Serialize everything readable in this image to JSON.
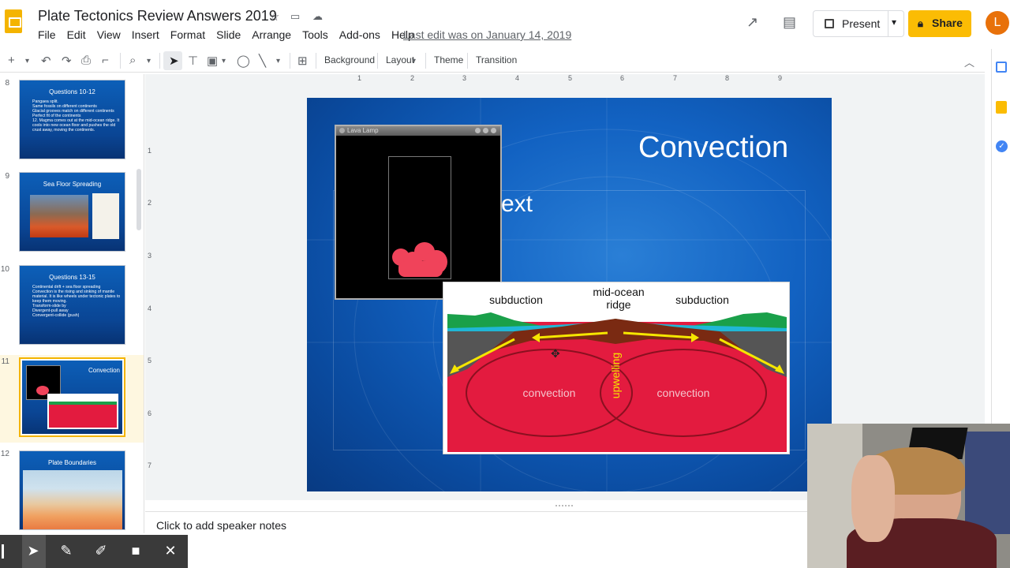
{
  "document": {
    "title": "Plate Tectonics Review Answers 2019",
    "last_edit": "Last edit was on January 14, 2019"
  },
  "menu": [
    "File",
    "Edit",
    "View",
    "Insert",
    "Format",
    "Slide",
    "Arrange",
    "Tools",
    "Add-ons",
    "Help"
  ],
  "header_actions": {
    "present_label": "Present",
    "share_label": "Share",
    "avatar_initial": "L"
  },
  "toolbar": {
    "background_label": "Background",
    "layout_label": "Layout",
    "theme_label": "Theme",
    "transition_label": "Transition"
  },
  "ruler": {
    "horizontal": [
      "1",
      "2",
      "3",
      "4",
      "5",
      "6",
      "7",
      "8",
      "9"
    ],
    "vertical": [
      "1",
      "2",
      "3",
      "4",
      "5",
      "6",
      "7"
    ]
  },
  "slides": [
    {
      "number": "8",
      "title": "Questions 10-12",
      "body": "Pangaea split.\nSame fossils on different continents\nGlacial grooves match on different continents\nPerfect fit of the continents\n12. Magma comes out at the mid-ocean ridge. It cools into new ocean floor and pushes the old crust away, moving the continents."
    },
    {
      "number": "9",
      "title": "Sea Floor Spreading",
      "body": ""
    },
    {
      "number": "10",
      "title": "Questions 13-15",
      "body": "Continental drift + sea floor spreading\nConvection is the rising and sinking of mantle material. It is like wheels under tectonic plates to keep them moving.\nTransform-slide by\nDivergent-pull away\nConvergent-collide (push)"
    },
    {
      "number": "11",
      "title": "Convection",
      "body": ""
    },
    {
      "number": "12",
      "title": "Plate Boundaries",
      "body": ""
    }
  ],
  "selected_slide": "11",
  "slide": {
    "title": "Convection",
    "placeholder_fragment": "ext",
    "lava_window_title": "Lava Lamp",
    "diagram": {
      "label_left": "subduction",
      "label_center": "mid-ocean\nridge",
      "label_right": "subduction",
      "convection_left": "convection",
      "convection_right": "convection",
      "upwelling": "upwelling"
    }
  },
  "speaker_notes_placeholder": "Click to add speaker notes",
  "colors": {
    "slide_blue": "#1262c2",
    "share_yellow": "#fbbc04",
    "selection_gold": "#f4b400",
    "mantle_red": "#e31b3f",
    "crust_brown": "#7a2a12"
  }
}
